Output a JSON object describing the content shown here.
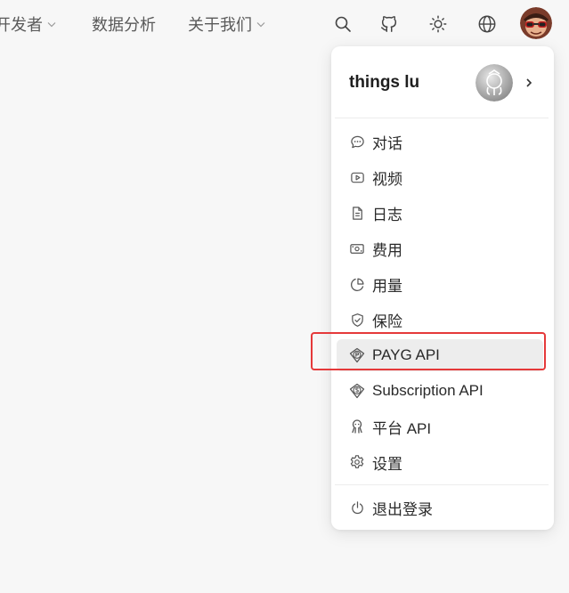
{
  "nav": {
    "items": [
      {
        "label": "开发者"
      },
      {
        "label": "数据分析"
      },
      {
        "label": "关于我们"
      }
    ],
    "icons": [
      "search-icon",
      "github-icon",
      "sun-icon",
      "globe-icon"
    ]
  },
  "menu": {
    "username": "things lu",
    "items": [
      {
        "label": "对话",
        "icon": "chat-bubble-icon"
      },
      {
        "label": "视频",
        "icon": "video-icon"
      },
      {
        "label": "日志",
        "icon": "document-icon"
      },
      {
        "label": "费用",
        "icon": "banknote-icon"
      },
      {
        "label": "用量",
        "icon": "pie-chart-icon"
      },
      {
        "label": "保险",
        "icon": "shield-icon"
      },
      {
        "label": "PAYG API",
        "icon": "p-badge-icon"
      },
      {
        "label": "Subscription API",
        "icon": "dollar-badge-icon"
      },
      {
        "label": "平台 API",
        "icon": "octopus-icon"
      },
      {
        "label": "设置",
        "icon": "gear-icon"
      }
    ],
    "logout": {
      "label": "退出登录",
      "icon": "power-icon"
    }
  },
  "colors": {
    "highlight_box": "#e5393a",
    "active_item_bg": "#ededed"
  }
}
